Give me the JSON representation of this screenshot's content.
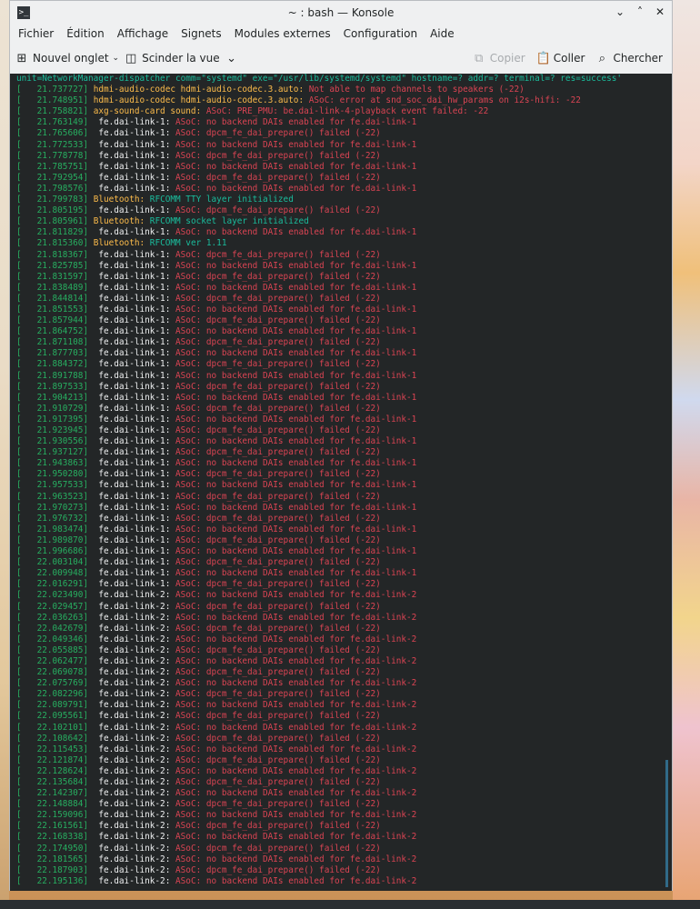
{
  "window": {
    "title": "~ : bash — Konsole",
    "controls": [
      "⌄",
      "˄",
      "✕"
    ]
  },
  "menu": [
    "Fichier",
    "Édition",
    "Affichage",
    "Signets",
    "Modules externes",
    "Configuration",
    "Aide"
  ],
  "toolbar": {
    "new_tab": "Nouvel onglet",
    "split_view": "Scinder la vue",
    "copy": "Copier",
    "paste": "Coller",
    "search": "Chercher"
  },
  "terminal": {
    "lines": [
      {
        "ts": "",
        "src": "",
        "msg": "unit=NetworkManager-dispatcher comm=\"systemd\" exe=\"/usr/lib/systemd/systemd\" hostname=? addr=? terminal=? res=success'",
        "src_color": "",
        "msg_color": "cyan"
      },
      {
        "ts": "[   21.737727]",
        "src": "hdmi-audio-codec hdmi-audio-codec.3.auto:",
        "msg": "Not able to map channels to speakers (-22)",
        "src_color": "yellow",
        "msg_color": "red"
      },
      {
        "ts": "[   21.748951]",
        "src": "hdmi-audio-codec hdmi-audio-codec.3.auto:",
        "msg": "ASoC: error at snd_soc_dai_hw_params on i2s-hifi: -22",
        "src_color": "yellow",
        "msg_color": "red"
      },
      {
        "ts": "[   21.758821]",
        "src": "axg-sound-card sound:",
        "msg": "ASoC: PRE_PMU: be.dai-link-4-playback event failed: -22",
        "src_color": "yellow",
        "msg_color": "red"
      },
      {
        "ts": "[   21.763149]",
        "src": " fe.dai-link-1:",
        "msg": "ASoC: no backend DAIs enabled for fe.dai-link-1",
        "src_color": "white",
        "msg_color": "red"
      },
      {
        "ts": "[   21.765606]",
        "src": " fe.dai-link-1:",
        "msg": "ASoC: dpcm_fe_dai_prepare() failed (-22)",
        "src_color": "white",
        "msg_color": "red"
      },
      {
        "ts": "[   21.772533]",
        "src": " fe.dai-link-1:",
        "msg": "ASoC: no backend DAIs enabled for fe.dai-link-1",
        "src_color": "white",
        "msg_color": "red"
      },
      {
        "ts": "[   21.778778]",
        "src": " fe.dai-link-1:",
        "msg": "ASoC: dpcm_fe_dai_prepare() failed (-22)",
        "src_color": "white",
        "msg_color": "red"
      },
      {
        "ts": "[   21.785751]",
        "src": " fe.dai-link-1:",
        "msg": "ASoC: no backend DAIs enabled for fe.dai-link-1",
        "src_color": "white",
        "msg_color": "red"
      },
      {
        "ts": "[   21.792954]",
        "src": " fe.dai-link-1:",
        "msg": "ASoC: dpcm_fe_dai_prepare() failed (-22)",
        "src_color": "white",
        "msg_color": "red"
      },
      {
        "ts": "[   21.798576]",
        "src": " fe.dai-link-1:",
        "msg": "ASoC: no backend DAIs enabled for fe.dai-link-1",
        "src_color": "white",
        "msg_color": "red"
      },
      {
        "ts": "[   21.799783]",
        "src": "Bluetooth:",
        "msg": "RFCOMM TTY layer initialized",
        "src_color": "yellow",
        "msg_color": "cyan"
      },
      {
        "ts": "[   21.805195]",
        "src": " fe.dai-link-1:",
        "msg": "ASoC: dpcm_fe_dai_prepare() failed (-22)",
        "src_color": "white",
        "msg_color": "red"
      },
      {
        "ts": "[   21.805961]",
        "src": "Bluetooth:",
        "msg": "RFCOMM socket layer initialized",
        "src_color": "yellow",
        "msg_color": "cyan"
      },
      {
        "ts": "[   21.811829]",
        "src": " fe.dai-link-1:",
        "msg": "ASoC: no backend DAIs enabled for fe.dai-link-1",
        "src_color": "white",
        "msg_color": "red"
      },
      {
        "ts": "[   21.815360]",
        "src": "Bluetooth:",
        "msg": "RFCOMM ver 1.11",
        "src_color": "yellow",
        "msg_color": "cyan"
      },
      {
        "ts": "[   21.818367]",
        "src": " fe.dai-link-1:",
        "msg": "ASoC: dpcm_fe_dai_prepare() failed (-22)",
        "src_color": "white",
        "msg_color": "red"
      },
      {
        "ts": "[   21.825785]",
        "src": " fe.dai-link-1:",
        "msg": "ASoC: no backend DAIs enabled for fe.dai-link-1",
        "src_color": "white",
        "msg_color": "red"
      },
      {
        "ts": "[   21.831597]",
        "src": " fe.dai-link-1:",
        "msg": "ASoC: dpcm_fe_dai_prepare() failed (-22)",
        "src_color": "white",
        "msg_color": "red"
      },
      {
        "ts": "[   21.838489]",
        "src": " fe.dai-link-1:",
        "msg": "ASoC: no backend DAIs enabled for fe.dai-link-1",
        "src_color": "white",
        "msg_color": "red"
      },
      {
        "ts": "[   21.844814]",
        "src": " fe.dai-link-1:",
        "msg": "ASoC: dpcm_fe_dai_prepare() failed (-22)",
        "src_color": "white",
        "msg_color": "red"
      },
      {
        "ts": "[   21.851553]",
        "src": " fe.dai-link-1:",
        "msg": "ASoC: no backend DAIs enabled for fe.dai-link-1",
        "src_color": "white",
        "msg_color": "red"
      },
      {
        "ts": "[   21.857944]",
        "src": " fe.dai-link-1:",
        "msg": "ASoC: dpcm_fe_dai_prepare() failed (-22)",
        "src_color": "white",
        "msg_color": "red"
      },
      {
        "ts": "[   21.864752]",
        "src": " fe.dai-link-1:",
        "msg": "ASoC: no backend DAIs enabled for fe.dai-link-1",
        "src_color": "white",
        "msg_color": "red"
      },
      {
        "ts": "[   21.871108]",
        "src": " fe.dai-link-1:",
        "msg": "ASoC: dpcm_fe_dai_prepare() failed (-22)",
        "src_color": "white",
        "msg_color": "red"
      },
      {
        "ts": "[   21.877703]",
        "src": " fe.dai-link-1:",
        "msg": "ASoC: no backend DAIs enabled for fe.dai-link-1",
        "src_color": "white",
        "msg_color": "red"
      },
      {
        "ts": "[   21.884372]",
        "src": " fe.dai-link-1:",
        "msg": "ASoC: dpcm_fe_dai_prepare() failed (-22)",
        "src_color": "white",
        "msg_color": "red"
      },
      {
        "ts": "[   21.891788]",
        "src": " fe.dai-link-1:",
        "msg": "ASoC: no backend DAIs enabled for fe.dai-link-1",
        "src_color": "white",
        "msg_color": "red"
      },
      {
        "ts": "[   21.897533]",
        "src": " fe.dai-link-1:",
        "msg": "ASoC: dpcm_fe_dai_prepare() failed (-22)",
        "src_color": "white",
        "msg_color": "red"
      },
      {
        "ts": "[   21.904213]",
        "src": " fe.dai-link-1:",
        "msg": "ASoC: no backend DAIs enabled for fe.dai-link-1",
        "src_color": "white",
        "msg_color": "red"
      },
      {
        "ts": "[   21.910729]",
        "src": " fe.dai-link-1:",
        "msg": "ASoC: dpcm_fe_dai_prepare() failed (-22)",
        "src_color": "white",
        "msg_color": "red"
      },
      {
        "ts": "[   21.917395]",
        "src": " fe.dai-link-1:",
        "msg": "ASoC: no backend DAIs enabled for fe.dai-link-1",
        "src_color": "white",
        "msg_color": "red"
      },
      {
        "ts": "[   21.923945]",
        "src": " fe.dai-link-1:",
        "msg": "ASoC: dpcm_fe_dai_prepare() failed (-22)",
        "src_color": "white",
        "msg_color": "red"
      },
      {
        "ts": "[   21.930556]",
        "src": " fe.dai-link-1:",
        "msg": "ASoC: no backend DAIs enabled for fe.dai-link-1",
        "src_color": "white",
        "msg_color": "red"
      },
      {
        "ts": "[   21.937127]",
        "src": " fe.dai-link-1:",
        "msg": "ASoC: dpcm_fe_dai_prepare() failed (-22)",
        "src_color": "white",
        "msg_color": "red"
      },
      {
        "ts": "[   21.943863]",
        "src": " fe.dai-link-1:",
        "msg": "ASoC: no backend DAIs enabled for fe.dai-link-1",
        "src_color": "white",
        "msg_color": "red"
      },
      {
        "ts": "[   21.950280]",
        "src": " fe.dai-link-1:",
        "msg": "ASoC: dpcm_fe_dai_prepare() failed (-22)",
        "src_color": "white",
        "msg_color": "red"
      },
      {
        "ts": "[   21.957533]",
        "src": " fe.dai-link-1:",
        "msg": "ASoC: no backend DAIs enabled for fe.dai-link-1",
        "src_color": "white",
        "msg_color": "red"
      },
      {
        "ts": "[   21.963523]",
        "src": " fe.dai-link-1:",
        "msg": "ASoC: dpcm_fe_dai_prepare() failed (-22)",
        "src_color": "white",
        "msg_color": "red"
      },
      {
        "ts": "[   21.970273]",
        "src": " fe.dai-link-1:",
        "msg": "ASoC: no backend DAIs enabled for fe.dai-link-1",
        "src_color": "white",
        "msg_color": "red"
      },
      {
        "ts": "[   21.976732]",
        "src": " fe.dai-link-1:",
        "msg": "ASoC: dpcm_fe_dai_prepare() failed (-22)",
        "src_color": "white",
        "msg_color": "red"
      },
      {
        "ts": "[   21.983474]",
        "src": " fe.dai-link-1:",
        "msg": "ASoC: no backend DAIs enabled for fe.dai-link-1",
        "src_color": "white",
        "msg_color": "red"
      },
      {
        "ts": "[   21.989870]",
        "src": " fe.dai-link-1:",
        "msg": "ASoC: dpcm_fe_dai_prepare() failed (-22)",
        "src_color": "white",
        "msg_color": "red"
      },
      {
        "ts": "[   21.996686]",
        "src": " fe.dai-link-1:",
        "msg": "ASoC: no backend DAIs enabled for fe.dai-link-1",
        "src_color": "white",
        "msg_color": "red"
      },
      {
        "ts": "[   22.003104]",
        "src": " fe.dai-link-1:",
        "msg": "ASoC: dpcm_fe_dai_prepare() failed (-22)",
        "src_color": "white",
        "msg_color": "red"
      },
      {
        "ts": "[   22.009948]",
        "src": " fe.dai-link-1:",
        "msg": "ASoC: no backend DAIs enabled for fe.dai-link-1",
        "src_color": "white",
        "msg_color": "red"
      },
      {
        "ts": "[   22.016291]",
        "src": " fe.dai-link-1:",
        "msg": "ASoC: dpcm_fe_dai_prepare() failed (-22)",
        "src_color": "white",
        "msg_color": "red"
      },
      {
        "ts": "[   22.023490]",
        "src": " fe.dai-link-2:",
        "msg": "ASoC: no backend DAIs enabled for fe.dai-link-2",
        "src_color": "white",
        "msg_color": "red"
      },
      {
        "ts": "[   22.029457]",
        "src": " fe.dai-link-2:",
        "msg": "ASoC: dpcm_fe_dai_prepare() failed (-22)",
        "src_color": "white",
        "msg_color": "red"
      },
      {
        "ts": "[   22.036263]",
        "src": " fe.dai-link-2:",
        "msg": "ASoC: no backend DAIs enabled for fe.dai-link-2",
        "src_color": "white",
        "msg_color": "red"
      },
      {
        "ts": "[   22.042679]",
        "src": " fe.dai-link-2:",
        "msg": "ASoC: dpcm_fe_dai_prepare() failed (-22)",
        "src_color": "white",
        "msg_color": "red"
      },
      {
        "ts": "[   22.049346]",
        "src": " fe.dai-link-2:",
        "msg": "ASoC: no backend DAIs enabled for fe.dai-link-2",
        "src_color": "white",
        "msg_color": "red"
      },
      {
        "ts": "[   22.055885]",
        "src": " fe.dai-link-2:",
        "msg": "ASoC: dpcm_fe_dai_prepare() failed (-22)",
        "src_color": "white",
        "msg_color": "red"
      },
      {
        "ts": "[   22.062477]",
        "src": " fe.dai-link-2:",
        "msg": "ASoC: no backend DAIs enabled for fe.dai-link-2",
        "src_color": "white",
        "msg_color": "red"
      },
      {
        "ts": "[   22.069078]",
        "src": " fe.dai-link-2:",
        "msg": "ASoC: dpcm_fe_dai_prepare() failed (-22)",
        "src_color": "white",
        "msg_color": "red"
      },
      {
        "ts": "[   22.075769]",
        "src": " fe.dai-link-2:",
        "msg": "ASoC: no backend DAIs enabled for fe.dai-link-2",
        "src_color": "white",
        "msg_color": "red"
      },
      {
        "ts": "[   22.082296]",
        "src": " fe.dai-link-2:",
        "msg": "ASoC: dpcm_fe_dai_prepare() failed (-22)",
        "src_color": "white",
        "msg_color": "red"
      },
      {
        "ts": "[   22.089791]",
        "src": " fe.dai-link-2:",
        "msg": "ASoC: no backend DAIs enabled for fe.dai-link-2",
        "src_color": "white",
        "msg_color": "red"
      },
      {
        "ts": "[   22.095561]",
        "src": " fe.dai-link-2:",
        "msg": "ASoC: dpcm_fe_dai_prepare() failed (-22)",
        "src_color": "white",
        "msg_color": "red"
      },
      {
        "ts": "[   22.102101]",
        "src": " fe.dai-link-2:",
        "msg": "ASoC: no backend DAIs enabled for fe.dai-link-2",
        "src_color": "white",
        "msg_color": "red"
      },
      {
        "ts": "[   22.108642]",
        "src": " fe.dai-link-2:",
        "msg": "ASoC: dpcm_fe_dai_prepare() failed (-22)",
        "src_color": "white",
        "msg_color": "red"
      },
      {
        "ts": "[   22.115453]",
        "src": " fe.dai-link-2:",
        "msg": "ASoC: no backend DAIs enabled for fe.dai-link-2",
        "src_color": "white",
        "msg_color": "red"
      },
      {
        "ts": "[   22.121874]",
        "src": " fe.dai-link-2:",
        "msg": "ASoC: dpcm_fe_dai_prepare() failed (-22)",
        "src_color": "white",
        "msg_color": "red"
      },
      {
        "ts": "[   22.128624]",
        "src": " fe.dai-link-2:",
        "msg": "ASoC: no backend DAIs enabled for fe.dai-link-2",
        "src_color": "white",
        "msg_color": "red"
      },
      {
        "ts": "[   22.135684]",
        "src": " fe.dai-link-2:",
        "msg": "ASoC: dpcm_fe_dai_prepare() failed (-22)",
        "src_color": "white",
        "msg_color": "red"
      },
      {
        "ts": "[   22.142307]",
        "src": " fe.dai-link-2:",
        "msg": "ASoC: no backend DAIs enabled for fe.dai-link-2",
        "src_color": "white",
        "msg_color": "red"
      },
      {
        "ts": "[   22.148884]",
        "src": " fe.dai-link-2:",
        "msg": "ASoC: dpcm_fe_dai_prepare() failed (-22)",
        "src_color": "white",
        "msg_color": "red"
      },
      {
        "ts": "[   22.159096]",
        "src": " fe.dai-link-2:",
        "msg": "ASoC: no backend DAIs enabled for fe.dai-link-2",
        "src_color": "white",
        "msg_color": "red"
      },
      {
        "ts": "[   22.161561]",
        "src": " fe.dai-link-2:",
        "msg": "ASoC: dpcm_fe_dai_prepare() failed (-22)",
        "src_color": "white",
        "msg_color": "red"
      },
      {
        "ts": "[   22.168338]",
        "src": " fe.dai-link-2:",
        "msg": "ASoC: no backend DAIs enabled for fe.dai-link-2",
        "src_color": "white",
        "msg_color": "red"
      },
      {
        "ts": "[   22.174950]",
        "src": " fe.dai-link-2:",
        "msg": "ASoC: dpcm_fe_dai_prepare() failed (-22)",
        "src_color": "white",
        "msg_color": "red"
      },
      {
        "ts": "[   22.181565]",
        "src": " fe.dai-link-2:",
        "msg": "ASoC: no backend DAIs enabled for fe.dai-link-2",
        "src_color": "white",
        "msg_color": "red"
      },
      {
        "ts": "[   22.187903]",
        "src": " fe.dai-link-2:",
        "msg": "ASoC: dpcm_fe_dai_prepare() failed (-22)",
        "src_color": "white",
        "msg_color": "red"
      },
      {
        "ts": "[   22.195136]",
        "src": " fe.dai-link-2:",
        "msg": "ASoC: no backend DAIs enabled for fe.dai-link-2",
        "src_color": "white",
        "msg_color": "red"
      }
    ]
  },
  "colors": {
    "terminal_bg": "#232627",
    "timestamp": "#27ae60",
    "error": "#da4453",
    "info": "#1abc9c",
    "source_highlight": "#fdbc4b"
  }
}
